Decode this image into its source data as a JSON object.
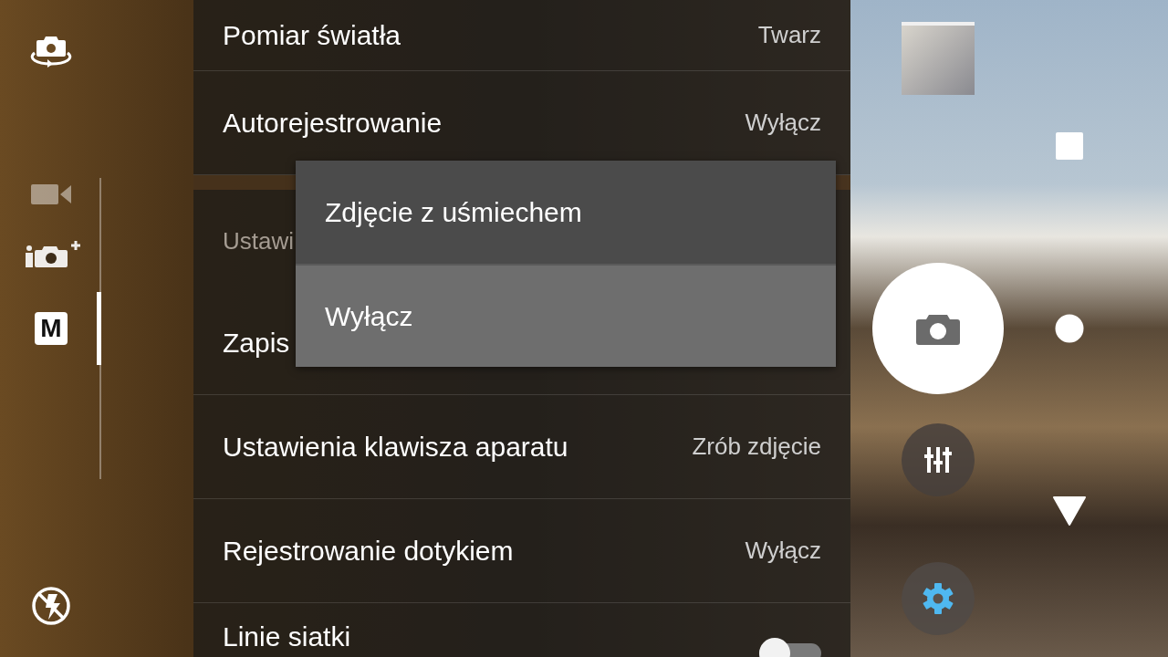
{
  "mode_rail": {
    "modes": [
      {
        "kind": "video",
        "selected": false
      },
      {
        "kind": "superior_auto",
        "selected": false
      },
      {
        "kind": "manual",
        "label": "M",
        "selected": true
      }
    ]
  },
  "settings": [
    {
      "kind": "row",
      "label": "Pomiar światła",
      "value": "Twarz"
    },
    {
      "kind": "row",
      "label": "Autorejestrowanie",
      "value": "Wyłącz"
    },
    {
      "kind": "header",
      "label": "Ustawi"
    },
    {
      "kind": "row",
      "label": "Zapis"
    },
    {
      "kind": "row",
      "label": "Ustawienia klawisza aparatu",
      "value": "Zrób zdjęcie"
    },
    {
      "kind": "row",
      "label": "Rejestrowanie dotykiem",
      "value": "Wyłącz"
    },
    {
      "kind": "toggle",
      "label": "Linie siatki",
      "on": false
    }
  ],
  "popup_menu": {
    "options": [
      {
        "label": "Zdjęcie z uśmiechem",
        "selected": false
      },
      {
        "label": "Wyłącz",
        "selected": true
      }
    ]
  }
}
